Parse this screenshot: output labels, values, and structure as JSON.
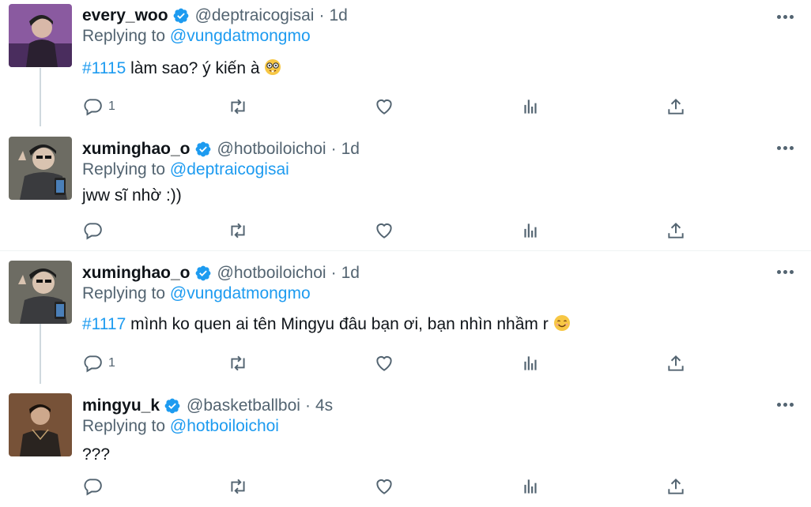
{
  "tweets": [
    {
      "display_name": "every_woo",
      "handle": "@deptraicogisai",
      "separator": "·",
      "time": "1d",
      "replying_prefix": "Replying to",
      "replying_to": "@vungdatmongmo",
      "hashtag": "#1115",
      "text": " làm sao? ý kiến à ",
      "emoji": "nerd-face",
      "reply_count": "1",
      "avatar_color": "#7a4a8c"
    },
    {
      "display_name": "xuminghao_o",
      "handle": "@hotboiloichoi",
      "separator": "·",
      "time": "1d",
      "replying_prefix": "Replying to",
      "replying_to": "@deptraicogisai",
      "hashtag": "",
      "text": "jww sĩ nhờ :))",
      "emoji": "",
      "reply_count": "",
      "avatar_color": "#5b5a52"
    },
    {
      "display_name": "xuminghao_o",
      "handle": "@hotboiloichoi",
      "separator": "·",
      "time": "1d",
      "replying_prefix": "Replying to",
      "replying_to": "@vungdatmongmo",
      "hashtag": "#1117",
      "text": " mình ko quen ai tên Mingyu đâu bạn ơi, bạn nhìn nhầm r ",
      "emoji": "smiling-face",
      "reply_count": "1",
      "avatar_color": "#5b5a52"
    },
    {
      "display_name": "mingyu_k",
      "handle": "@basketballboi",
      "separator": "·",
      "time": "4s",
      "replying_prefix": "Replying to",
      "replying_to": "@hotboiloichoi",
      "hashtag": "",
      "text": "???",
      "emoji": "",
      "reply_count": "",
      "avatar_color": "#6b4a30"
    }
  ],
  "colors": {
    "accent": "#1d9bf0",
    "secondary_text": "#536471",
    "divider": "#eff3f4"
  },
  "icons": [
    "verified-badge-icon",
    "more-icon",
    "reply-icon",
    "retweet-icon",
    "like-icon",
    "analytics-icon",
    "share-icon"
  ]
}
